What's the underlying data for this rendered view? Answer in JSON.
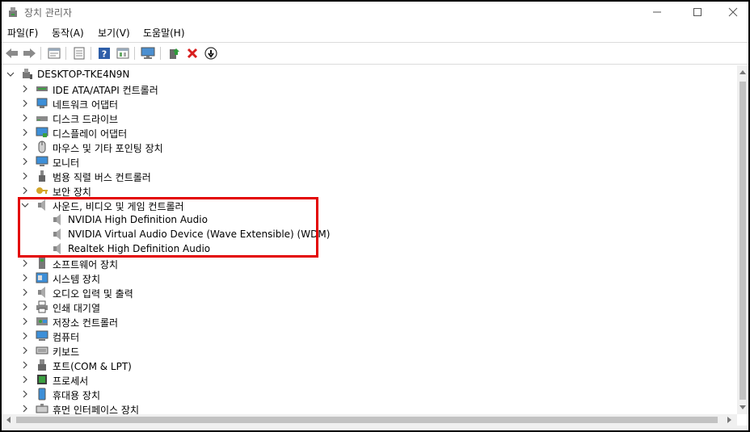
{
  "window": {
    "title": "장치 관리자"
  },
  "menu": [
    "파일(F)",
    "동작(A)",
    "보기(V)",
    "도움말(H)"
  ],
  "toolbar": {
    "icons": [
      "back-arrow-icon",
      "forward-arrow-icon",
      "properties-icon",
      "show-hidden-icon",
      "help-icon",
      "run-icon",
      "computer-monitor-icon",
      "update-driver-icon",
      "uninstall-icon",
      "disable-device-icon"
    ]
  },
  "tree": {
    "root": "DESKTOP-TKE4N9N",
    "categories": [
      {
        "label": "IDE ATA/ATAPI 컨트롤러",
        "icon": "ide-controller-icon"
      },
      {
        "label": "네트워크 어댑터",
        "icon": "network-adapter-icon"
      },
      {
        "label": "디스크 드라이브",
        "icon": "disk-drive-icon"
      },
      {
        "label": "디스플레이 어댑터",
        "icon": "display-adapter-icon"
      },
      {
        "label": "마우스 및 기타 포인팅 장치",
        "icon": "mouse-icon"
      },
      {
        "label": "모니터",
        "icon": "monitor-icon"
      },
      {
        "label": "범용 직렬 버스 컨트롤러",
        "icon": "usb-icon"
      },
      {
        "label": "보안 장치",
        "icon": "security-key-icon"
      },
      {
        "label": "사운드, 비디오 및 게임 컨트롤러",
        "icon": "speaker-icon",
        "expanded": true,
        "children": [
          "NVIDIA High Definition Audio",
          "NVIDIA Virtual Audio Device (Wave Extensible) (WDM)",
          "Realtek High Definition Audio"
        ]
      },
      {
        "label": "소프트웨어 장치",
        "icon": "software-device-icon"
      },
      {
        "label": "시스템 장치",
        "icon": "system-device-icon"
      },
      {
        "label": "오디오 입력 및 출력",
        "icon": "audio-io-icon"
      },
      {
        "label": "인쇄 대기열",
        "icon": "printer-icon"
      },
      {
        "label": "저장소 컨트롤러",
        "icon": "storage-controller-icon"
      },
      {
        "label": "컴퓨터",
        "icon": "computer-icon"
      },
      {
        "label": "키보드",
        "icon": "keyboard-icon"
      },
      {
        "label": "포트(COM & LPT)",
        "icon": "port-icon"
      },
      {
        "label": "프로세서",
        "icon": "processor-icon"
      },
      {
        "label": "휴대용 장치",
        "icon": "portable-device-icon"
      },
      {
        "label": "휴먼 인터페이스 장치",
        "icon": "hid-icon"
      }
    ]
  },
  "highlight_color": "#e30000"
}
